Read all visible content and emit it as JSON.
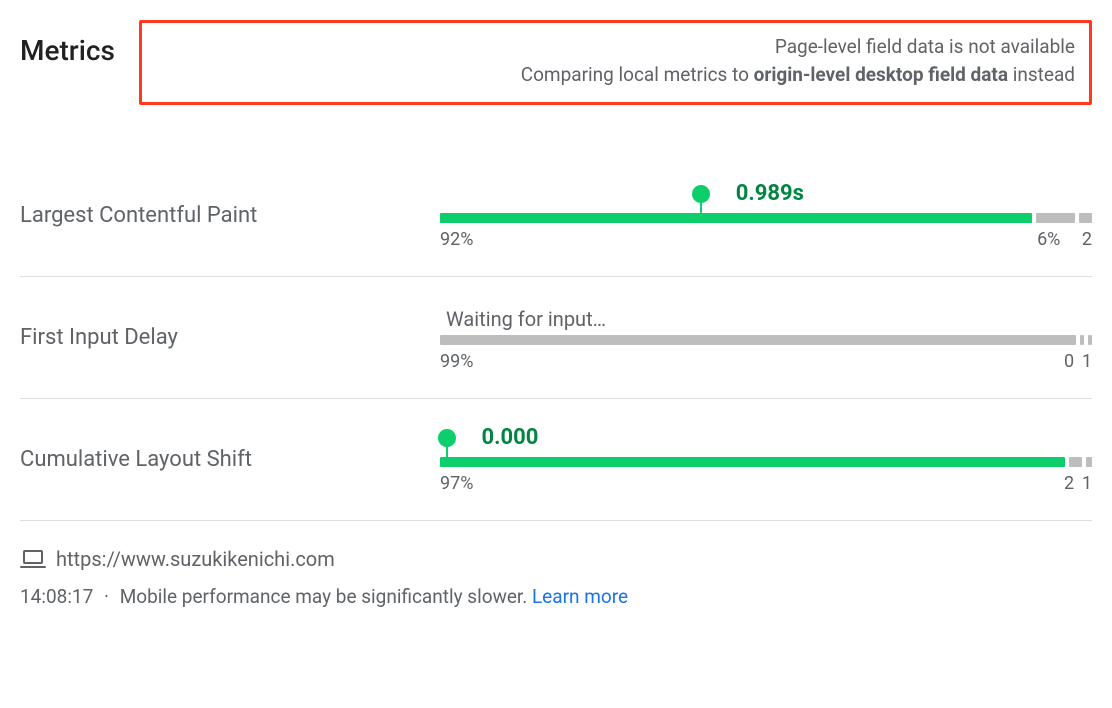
{
  "chart_data": [
    {
      "type": "bar",
      "name": "Largest Contentful Paint",
      "segments": [
        {
          "label": "92%",
          "value": 92,
          "color": "green"
        },
        {
          "label": "6%",
          "value": 6,
          "color": "gray"
        },
        {
          "label": "2",
          "value": 2,
          "color": "gray"
        }
      ],
      "marker": {
        "value": "0.989s",
        "position_pct": 40
      }
    },
    {
      "type": "bar",
      "name": "First Input Delay",
      "segments": [
        {
          "label": "99%",
          "value": 99,
          "color": "gray"
        },
        {
          "label": "0",
          "value": 0.5,
          "color": "gray"
        },
        {
          "label": "1",
          "value": 0.5,
          "color": "gray"
        }
      ],
      "status_text": "Waiting for input…"
    },
    {
      "type": "bar",
      "name": "Cumulative Layout Shift",
      "segments": [
        {
          "label": "97%",
          "value": 97,
          "color": "green"
        },
        {
          "label": "2",
          "value": 2,
          "color": "gray"
        },
        {
          "label": "1",
          "value": 1,
          "color": "gray"
        }
      ],
      "marker": {
        "value": "0.000",
        "position_pct": 1
      }
    }
  ],
  "header": {
    "title": "Metrics",
    "notice": {
      "line1": "Page-level field data is not available",
      "line2_prefix": "Comparing local metrics to ",
      "line2_bold": "origin-level desktop field data",
      "line2_suffix": " instead"
    }
  },
  "metrics": {
    "lcp": {
      "name": "Largest Contentful Paint",
      "value": "0.989s",
      "marker_pct": 40,
      "seg1_label": "92%",
      "seg2_label": "6%",
      "seg3_label": "2"
    },
    "fid": {
      "name": "First Input Delay",
      "status": "Waiting for input…",
      "seg1_label": "99%",
      "seg2_label": "0",
      "seg3_label": "1"
    },
    "cls": {
      "name": "Cumulative Layout Shift",
      "value": "0.000",
      "marker_pct": 1,
      "seg1_label": "97%",
      "seg2_label": "2",
      "seg3_label": "1"
    }
  },
  "footer": {
    "url": "https://www.suzukikenichi.com",
    "time": "14:08:17",
    "separator": "·",
    "mobile_note": "Mobile performance may be significantly slower.",
    "learn_more": "Learn more"
  }
}
